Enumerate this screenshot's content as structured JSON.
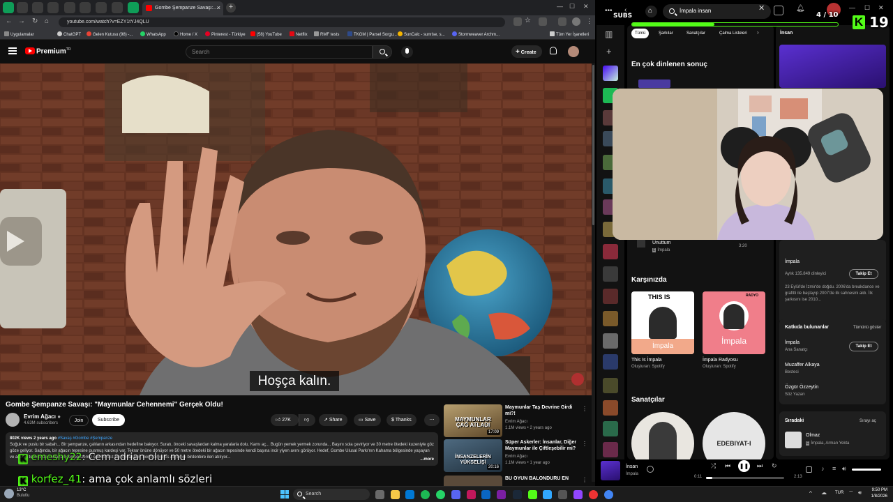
{
  "browser": {
    "tab_title": "Gombe Şempanze Savaşı: \"Ma",
    "url": "youtube.com/watch?v=EZY1tYJ4QLU",
    "bookmarks": [
      "Uygulamalar",
      "ChatGPT",
      "Gelen Kutusu (98) -...",
      "WhatsApp",
      "Home / X",
      "Pinterest - Türkiye",
      "(58) YouTube",
      "Netflix",
      "RMF tests",
      "TKGM | Parsel Sorgu...",
      "SunCalc - sunrise, s...",
      "Stormweaver Archm...",
      "Tüm Yer İşaretleri"
    ]
  },
  "youtube": {
    "logo": "Premium",
    "logo_sup": "TR",
    "search_placeholder": "Search",
    "create": "Create",
    "subtitle": "Hoşça kalın.",
    "video_title": "Gombe Şempanze Savaşı: \"Maymunlar Cehennemi\" Gerçek Oldu!",
    "channel": "Evrim Ağacı",
    "subscribers": "4.63M subscribers",
    "join": "Join",
    "subscribe": "Subscribe",
    "likes": "27K",
    "share": "Share",
    "save": "Save",
    "thanks": "Thanks",
    "desc_stats": "802K views  2 years ago",
    "desc_tags": "#Savaş #Gombe #Şempanze",
    "desc_text": "Soğuk ve puslu bir sabah... Bir şempanze, çalıların arkasından hedefine bakıyor. Suratı, önceki savaşlardan kalma yaralarla dolu. Karnı aç... Bugün yemek yermek zorunda... Başını sola çeviriyor ve 30 metre ötedeki kuzeniyle göz göze geliyor. Sağında, bir ağacın tepesine pusmuş kardeşi var. Tekrar önüne dönüyor ve 50 metre ötedeki bir ağacın tepesinde kendi başına incir yiyen avını görüyor. Hedef, Gombe Ulusal Parkı'nın Kahama bölgesinde yaşayan ve ağacın tepesinde saklanan şempanzemiz son bir kez homurdanıyor, derin bir nefes alıyor ve birdenbire ileri atılıyor...",
    "desc_more": "...more",
    "recs": [
      {
        "title": "Maymunlar Taş Devrine Girdi mi?!",
        "channel": "Evrim Ağacı",
        "meta": "1.1M views • 2 years ago",
        "dur": "17:09",
        "thumb_text": "MAYMUNLAR ÇAĞ ATLADI"
      },
      {
        "title": "Süper Askerler: İnsanlar, Diğer Maymunlar ile Çiftleşebilir mi?",
        "channel": "Evrim Ağacı",
        "meta": "1.1M views • 1 year ago",
        "dur": "20:16",
        "thumb_text": "İNSANZELERİN YÜKSELİŞİ"
      },
      {
        "title": "BU OYUN BALONDURU EN",
        "channel": "",
        "meta": "",
        "dur": "",
        "thumb_text": ""
      }
    ]
  },
  "overlay": {
    "chat": [
      {
        "user": "emeshy22",
        "msg": "Cem adrian olur mu"
      },
      {
        "user": "korfez_41",
        "msg": "ama çok anlamlı sözleri"
      }
    ],
    "subs_label": "SUBS",
    "subs_count": "4 / 10",
    "subs_progress": 0.4,
    "viewer_count": "19"
  },
  "spotify": {
    "search_value": "İmpala insan",
    "chips": [
      "Tümü",
      "Şarkılar",
      "Sanatçılar",
      "Çalma Listeleri"
    ],
    "top_result": "En çok dinlenen sonuç",
    "song_title": "Unuttum",
    "song_artist": "İmpala",
    "song_time": "3:20",
    "featuring_title": "Karşınızda",
    "cards": [
      {
        "title": "This Is İmpala",
        "sub": "Oluşturan: Spotify",
        "cover_top": "THIS IS",
        "cover_name": "İmpala"
      },
      {
        "title": "İmpala Radyosu",
        "sub": "Oluşturan: Spotify",
        "cover_top": "RADYO",
        "cover_name": "İmpala"
      }
    ],
    "artists_title": "Sanatçılar",
    "artist2_text": "EDEBIYAT-I",
    "right_header": "İnsan",
    "artist_name": "İmpala",
    "monthly": "Aylık 135.849 dinleyici",
    "follow": "Takip Et",
    "bio": "23 Eylül'de İzmir'de doğdu. 2006'da breakdance ve grafitti ile başlayıp 2007'de ilk sahnesini aldı. İlk şarkısını ise 2010...",
    "credits_title": "Katkıda bulunanlar",
    "credits_all": "Tümünü göster",
    "credits": [
      {
        "name": "İmpala",
        "role": "Ana Sanatçı"
      },
      {
        "name": "Muzaffer Alkaya",
        "role": "Besteci"
      },
      {
        "name": "Özgür Özzeytin",
        "role": "Söz Yazarı"
      }
    ],
    "queue_title": "Sıradaki",
    "queue_open": "Sırayı aç",
    "queue_song": "Olmaz",
    "queue_artist": "İmpala, Arman Yekta",
    "now_title": "İnsan",
    "now_artist": "İmpala",
    "elapsed": "0:11",
    "duration": "2:13",
    "progress": 0.08
  },
  "taskbar": {
    "weather_temp": "13°C",
    "weather_desc": "Bulutlu",
    "search": "Search",
    "lang": "TUR",
    "time": "9:50 PM",
    "date": "1/8/2026"
  },
  "colors": {
    "kick_green": "#53fc18",
    "yt_red": "#ff0000",
    "spotify_bg": "#121212"
  }
}
